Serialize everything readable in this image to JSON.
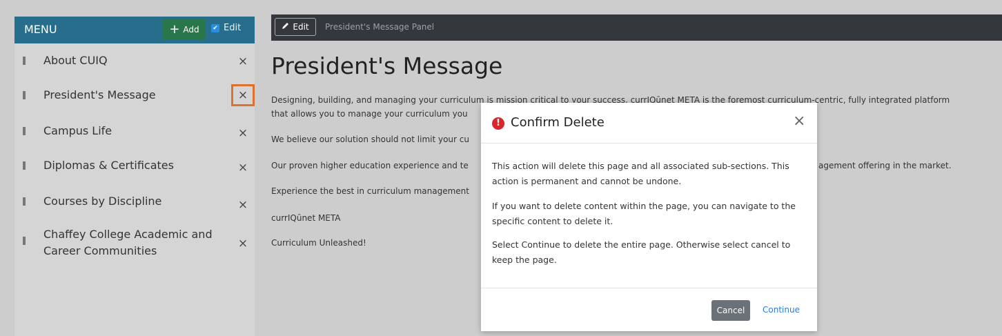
{
  "sidebar": {
    "title": "MENU",
    "add_label": "Add",
    "edit_label": "Edit",
    "items": [
      {
        "label": "About CUIQ"
      },
      {
        "label": "President's Message"
      },
      {
        "label": "Campus Life"
      },
      {
        "label": "Diplomas & Certificates"
      },
      {
        "label": "Courses by Discipline"
      },
      {
        "label_line1": "Chaffey College Academic and",
        "label_line2": "Career Communities"
      }
    ],
    "delete_glyph": "×"
  },
  "toolbar": {
    "edit_label": "Edit",
    "panel_title": "President's Message Panel"
  },
  "page": {
    "title": "President's Message",
    "paragraphs": [
      "Designing, building, and managing your curriculum is mission critical to your success. currIQūnet  META is the foremost curriculum-centric, fully integrated platform",
      "that allows you to manage your curriculum you",
      "We believe our solution should not limit your cu",
      "Our proven higher education experience and te",
      "agement offering in the market.",
      "Experience the best in curriculum management",
      "currIQūnet META",
      "Curriculum Unleashed!"
    ]
  },
  "modal": {
    "icon": "!",
    "title": "Confirm Delete",
    "close_glyph": "×",
    "body": [
      "This action will delete this page and all associated sub-sections. This action is permanent and cannot be undone.",
      "If you want to delete content within the page, you can navigate to the specific content to delete it.",
      "Select Continue to delete the entire page. Otherwise select cancel to keep the page."
    ],
    "cancel_label": "Cancel",
    "continue_label": "Continue"
  },
  "colors": {
    "menu_header": "#276d8c",
    "add_button": "#28764a",
    "highlight": "#e07030",
    "toolbar": "#34383d",
    "danger": "#d9262a",
    "link": "#2a7bd5"
  }
}
